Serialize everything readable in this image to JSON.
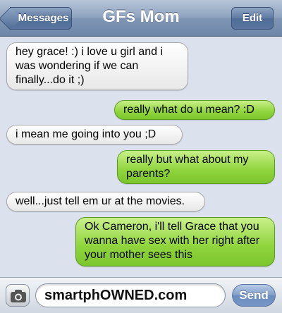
{
  "navbar": {
    "back_label": "Messages",
    "title": "GFs Mom",
    "edit_label": "Edit"
  },
  "messages": [
    {
      "from": "them",
      "text": "hey grace! :) i love u girl and i was wondering if we can finally...do it ;)"
    },
    {
      "from": "me",
      "text": "really what do u mean? :D"
    },
    {
      "from": "them",
      "text": "i mean me going into you ;D"
    },
    {
      "from": "me",
      "text": "really but what about my parents?"
    },
    {
      "from": "them",
      "text": "well...just tell em ur at the movies."
    },
    {
      "from": "me",
      "text": "Ok Cameron, i'll tell Grace that you wanna have sex with her right after your mother sees this"
    }
  ],
  "composer": {
    "camera_icon": "camera-icon",
    "input_value": "smartphOWNED.com",
    "send_label": "Send"
  },
  "colors": {
    "sent_bubble": "#8fd43c",
    "received_bubble": "#ececec",
    "background": "#dbe2ed",
    "navbar": "#7f95b4"
  }
}
